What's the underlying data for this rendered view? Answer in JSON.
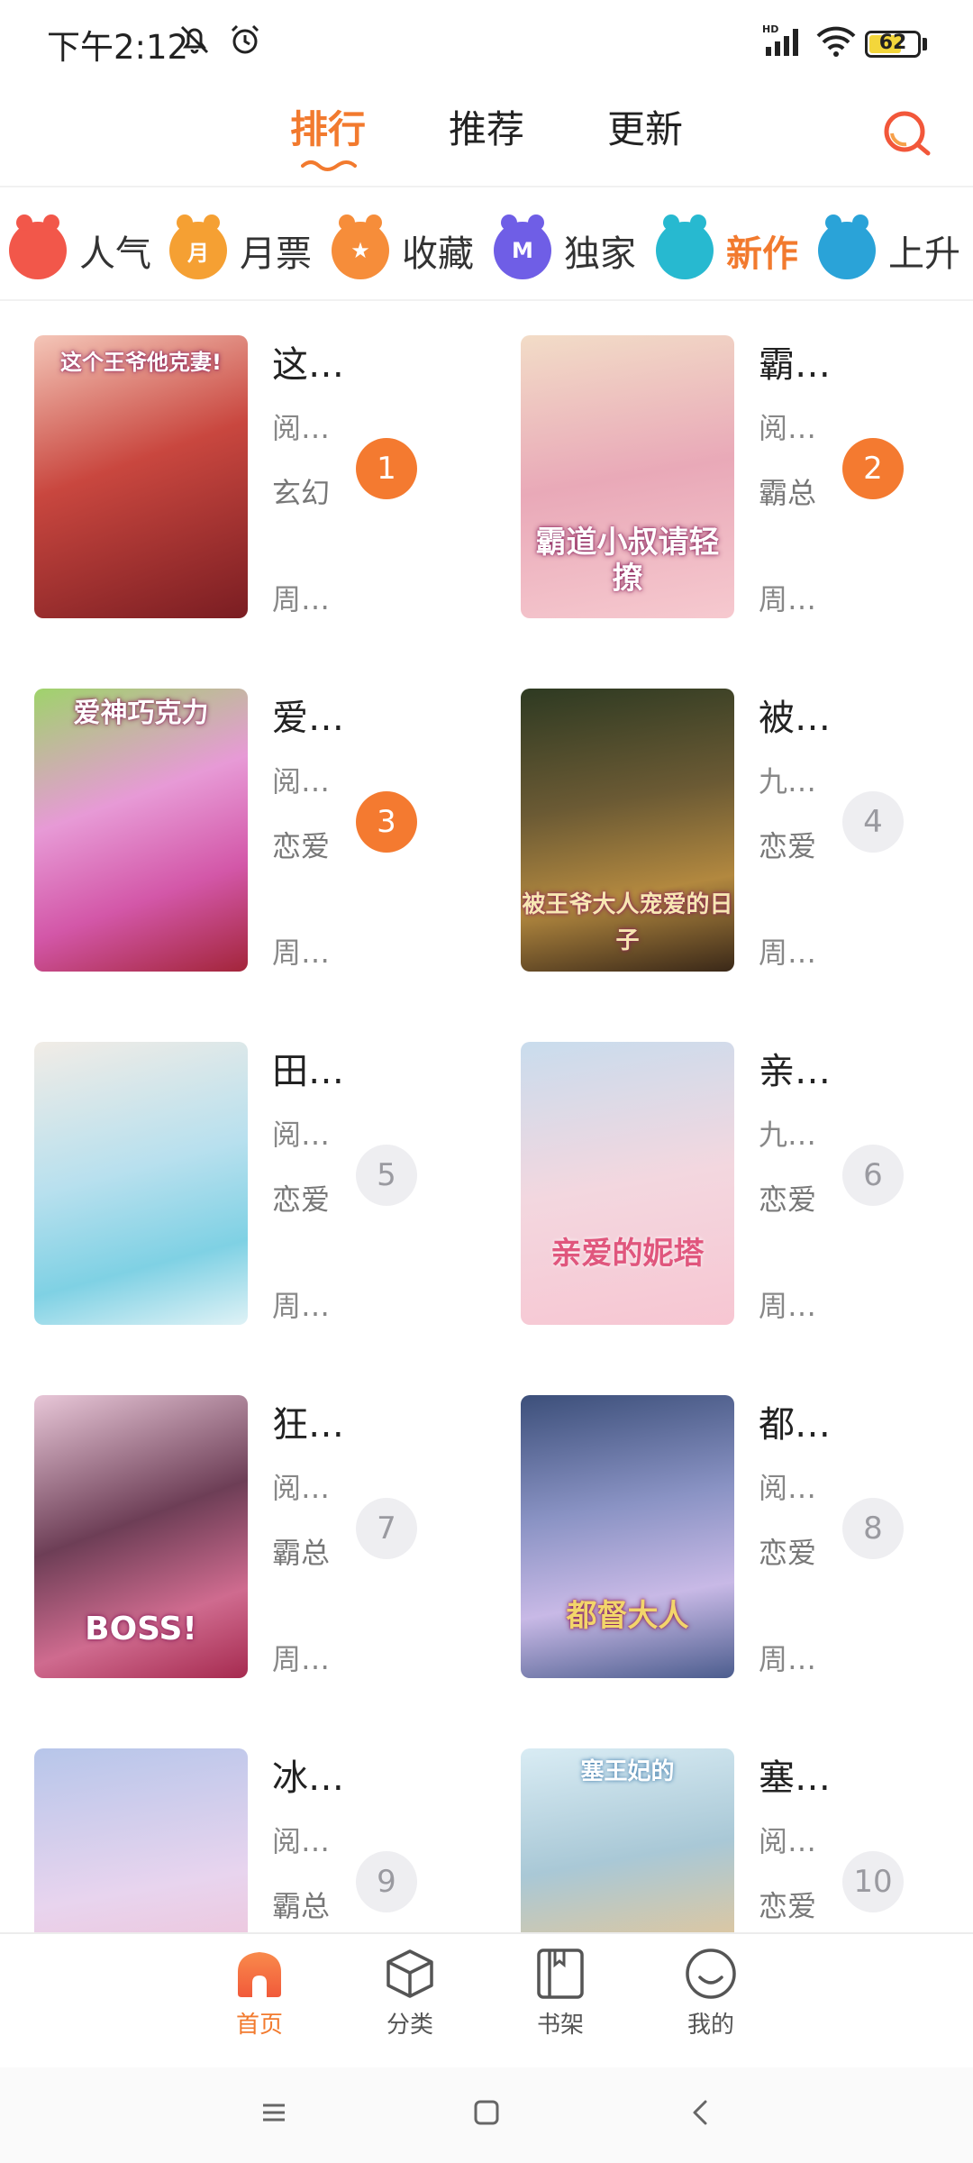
{
  "status_bar": {
    "time": "下午2:12",
    "network": "HD",
    "battery": "62",
    "battery_level": 0.62
  },
  "top_tabs": [
    {
      "label": "排行",
      "active": true
    },
    {
      "label": "推荐",
      "active": false
    },
    {
      "label": "更新",
      "active": false
    }
  ],
  "search": {
    "icon": "search-icon"
  },
  "categories": [
    {
      "label": "人气",
      "icon_text": "",
      "color": "#f2574a",
      "active": false
    },
    {
      "label": "月票",
      "icon_text": "月",
      "color": "#f5a033",
      "active": false
    },
    {
      "label": "收藏",
      "icon_text": "★",
      "color": "#f68d3a",
      "active": false
    },
    {
      "label": "独家",
      "icon_text": "M",
      "color": "#6f5ee6",
      "active": false
    },
    {
      "label": "新作",
      "icon_text": "",
      "color": "#27b9d0",
      "active": true
    },
    {
      "label": "上升",
      "icon_text": "",
      "color": "#2aa3d8",
      "active": false
    }
  ],
  "comics": [
    {
      "rank": "1",
      "name": "这…",
      "line2": "阅…",
      "genre": "玄幻",
      "line4": "周…",
      "cover_text": "这个王爷他克妻!",
      "top3": true
    },
    {
      "rank": "2",
      "name": "霸…",
      "line2": "阅…",
      "genre": "霸总",
      "line4": "周…",
      "cover_text": "霸道小叔请轻撩",
      "top3": true
    },
    {
      "rank": "3",
      "name": "爱…",
      "line2": "阅…",
      "genre": "恋爱",
      "line4": "周…",
      "cover_text": "爱神巧克力",
      "top3": true
    },
    {
      "rank": "4",
      "name": "被…",
      "line2": "九…",
      "genre": "恋爱",
      "line4": "周…",
      "cover_text": "被王爷大人宠爱的日子",
      "top3": false
    },
    {
      "rank": "5",
      "name": "田…",
      "line2": "阅…",
      "genre": "恋爱",
      "line4": "周…",
      "cover_text": "",
      "top3": false
    },
    {
      "rank": "6",
      "name": "亲…",
      "line2": "九…",
      "genre": "恋爱",
      "line4": "周…",
      "cover_text": "亲爱的妮塔",
      "top3": false
    },
    {
      "rank": "7",
      "name": "狂…",
      "line2": "阅…",
      "genre": "霸总",
      "line4": "周…",
      "cover_text": "BOSS!",
      "top3": false
    },
    {
      "rank": "8",
      "name": "都…",
      "line2": "阅…",
      "genre": "恋爱",
      "line4": "周…",
      "cover_text": "都督大人",
      "top3": false
    },
    {
      "rank": "9",
      "name": "冰…",
      "line2": "阅…",
      "genre": "霸总",
      "line4": "",
      "cover_text": "",
      "top3": false
    },
    {
      "rank": "10",
      "name": "塞…",
      "line2": "阅…",
      "genre": "恋爱",
      "line4": "",
      "cover_text": "塞王妃的",
      "top3": false
    }
  ],
  "bottom_nav": [
    {
      "label": "首页",
      "icon": "home-icon",
      "active": true
    },
    {
      "label": "分类",
      "icon": "cube-icon",
      "active": false
    },
    {
      "label": "书架",
      "icon": "book-icon",
      "active": false
    },
    {
      "label": "我的",
      "icon": "smile-icon",
      "active": false
    }
  ],
  "colors": {
    "accent": "#f27a2e",
    "rank_top": "#f47a30",
    "rank_normal_bg": "#eeeef1"
  }
}
